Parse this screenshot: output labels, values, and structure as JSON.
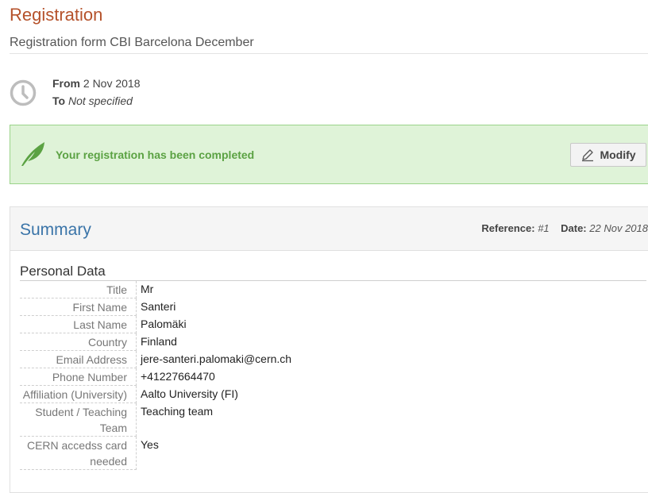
{
  "header": {
    "title": "Registration",
    "subtitle": "Registration form CBI Barcelona December"
  },
  "dates": {
    "from_label": "From",
    "from_value": "2 Nov 2018",
    "to_label": "To",
    "to_value": "Not specified"
  },
  "alert": {
    "message": "Your registration has been completed",
    "modify_label": "Modify",
    "colors": {
      "background": "#dff3d8",
      "border": "#9bd38a",
      "text": "#5ba243"
    }
  },
  "summary": {
    "title": "Summary",
    "reference_label": "Reference:",
    "reference_value": "#1",
    "date_label": "Date:",
    "date_value": "22 Nov 2018",
    "section_title": "Personal Data",
    "fields": [
      {
        "label": "Title",
        "value": "Mr"
      },
      {
        "label": "First Name",
        "value": "Santeri"
      },
      {
        "label": "Last Name",
        "value": "Palomäki"
      },
      {
        "label": "Country",
        "value": "Finland"
      },
      {
        "label": "Email Address",
        "value": "jere-santeri.palomaki@cern.ch"
      },
      {
        "label": "Phone Number",
        "value": "+41227664470"
      },
      {
        "label": "Affiliation (University)",
        "value": "Aalto University (FI)"
      },
      {
        "label": "Student / Teaching Team",
        "value": "Teaching team"
      },
      {
        "label": "CERN accedss card needed",
        "value": "Yes"
      }
    ]
  },
  "icons": [
    "clock-icon",
    "feather-icon",
    "pencil-icon"
  ]
}
